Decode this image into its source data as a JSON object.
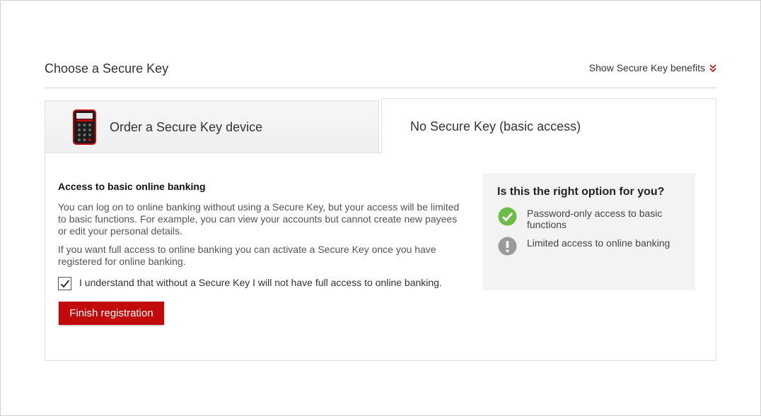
{
  "header": {
    "title": "Choose a Secure Key",
    "benefits_link": "Show Secure Key benefits"
  },
  "tabs": [
    {
      "label": "Order a Secure Key device",
      "selected": false,
      "icon": "secure-key-device-icon"
    },
    {
      "label": "No Secure Key (basic access)",
      "selected": true
    }
  ],
  "content": {
    "heading": "Access to basic online banking",
    "paragraph_1": "You can log on to online banking without using a Secure Key, but your access will be limited to basic functions. For example, you can view your accounts but cannot create new payees or edit your personal details.",
    "paragraph_2": "If you want full access to online banking you can activate a Secure Key once you have registered for online banking.",
    "checkbox_label": "I understand that without a Secure Key I will not have full access to online banking.",
    "checkbox_checked": true,
    "finish_button": "Finish registration"
  },
  "side_panel": {
    "title": "Is this the right option for you?",
    "items": [
      {
        "text": "Password-only access to basic functions",
        "icon": "check-circle-icon"
      },
      {
        "text": "Limited access to online banking",
        "icon": "exclamation-circle-icon"
      }
    ]
  },
  "colors": {
    "brand_red": "#c20a0a",
    "success_green": "#6cbd45",
    "neutral_grey": "#9a9a9a",
    "panel_bg": "#f3f3f3"
  }
}
